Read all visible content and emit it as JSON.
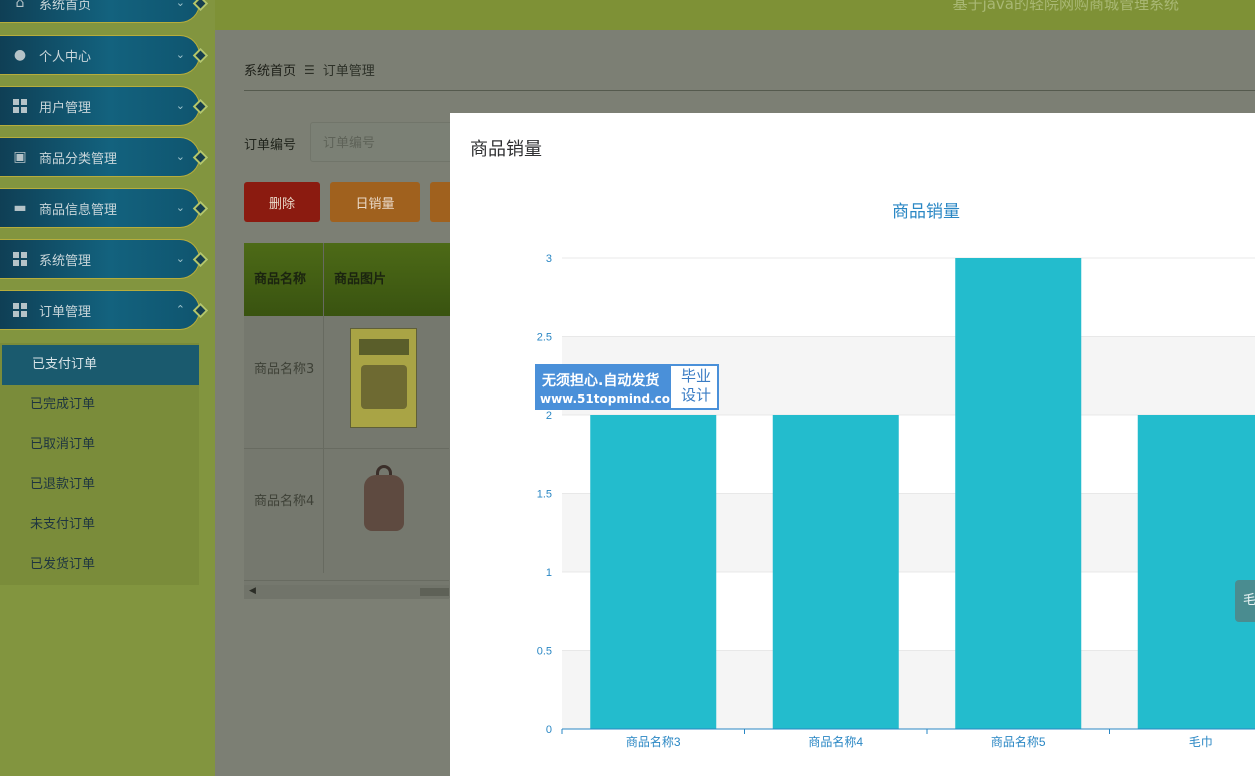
{
  "sidebar": {
    "items": [
      {
        "label": "系统首页"
      },
      {
        "label": "个人中心"
      },
      {
        "label": "用户管理"
      },
      {
        "label": "商品分类管理"
      },
      {
        "label": "商品信息管理"
      },
      {
        "label": "系统管理"
      },
      {
        "label": "订单管理"
      }
    ],
    "submenu": [
      {
        "label": "已支付订单"
      },
      {
        "label": "已完成订单"
      },
      {
        "label": "已取消订单"
      },
      {
        "label": "已退款订单"
      },
      {
        "label": "未支付订单"
      },
      {
        "label": "已发货订单"
      }
    ]
  },
  "header": {
    "title": "基于java的轻院网购商城管理系统"
  },
  "breadcrumb": {
    "home": "系统首页",
    "separator": "☰",
    "current": "订单管理"
  },
  "search": {
    "label": "订单编号",
    "placeholder": "订单编号"
  },
  "toolbar": {
    "delete_label": "删除",
    "daily_sales_label": "日销量"
  },
  "table": {
    "headers": {
      "name": "商品名称",
      "image": "商品图片"
    },
    "rows": [
      {
        "name": "商品名称3",
        "image_desc": "book cover"
      },
      {
        "name": "商品名称4",
        "image_desc": "backpack"
      }
    ]
  },
  "modal": {
    "title": "商品销量",
    "side_tab_label": "毛"
  },
  "watermark": {
    "slogan": "无须担心.自动发货",
    "url": "www.51topmind.com",
    "brand": "毕业设计"
  },
  "chart_data": {
    "type": "bar",
    "title": "商品销量",
    "categories": [
      "商品名称3",
      "商品名称4",
      "商品名称5",
      "毛巾"
    ],
    "values": [
      2,
      2,
      3,
      2
    ],
    "ylim": [
      0,
      3
    ],
    "yticks": [
      0,
      0.5,
      1,
      1.5,
      2,
      2.5,
      3
    ],
    "grid": true,
    "colors": {
      "bar": "#23bccd",
      "axis": "#2a87c4",
      "title": "#2a87c4",
      "band": "#f5f5f5"
    }
  }
}
